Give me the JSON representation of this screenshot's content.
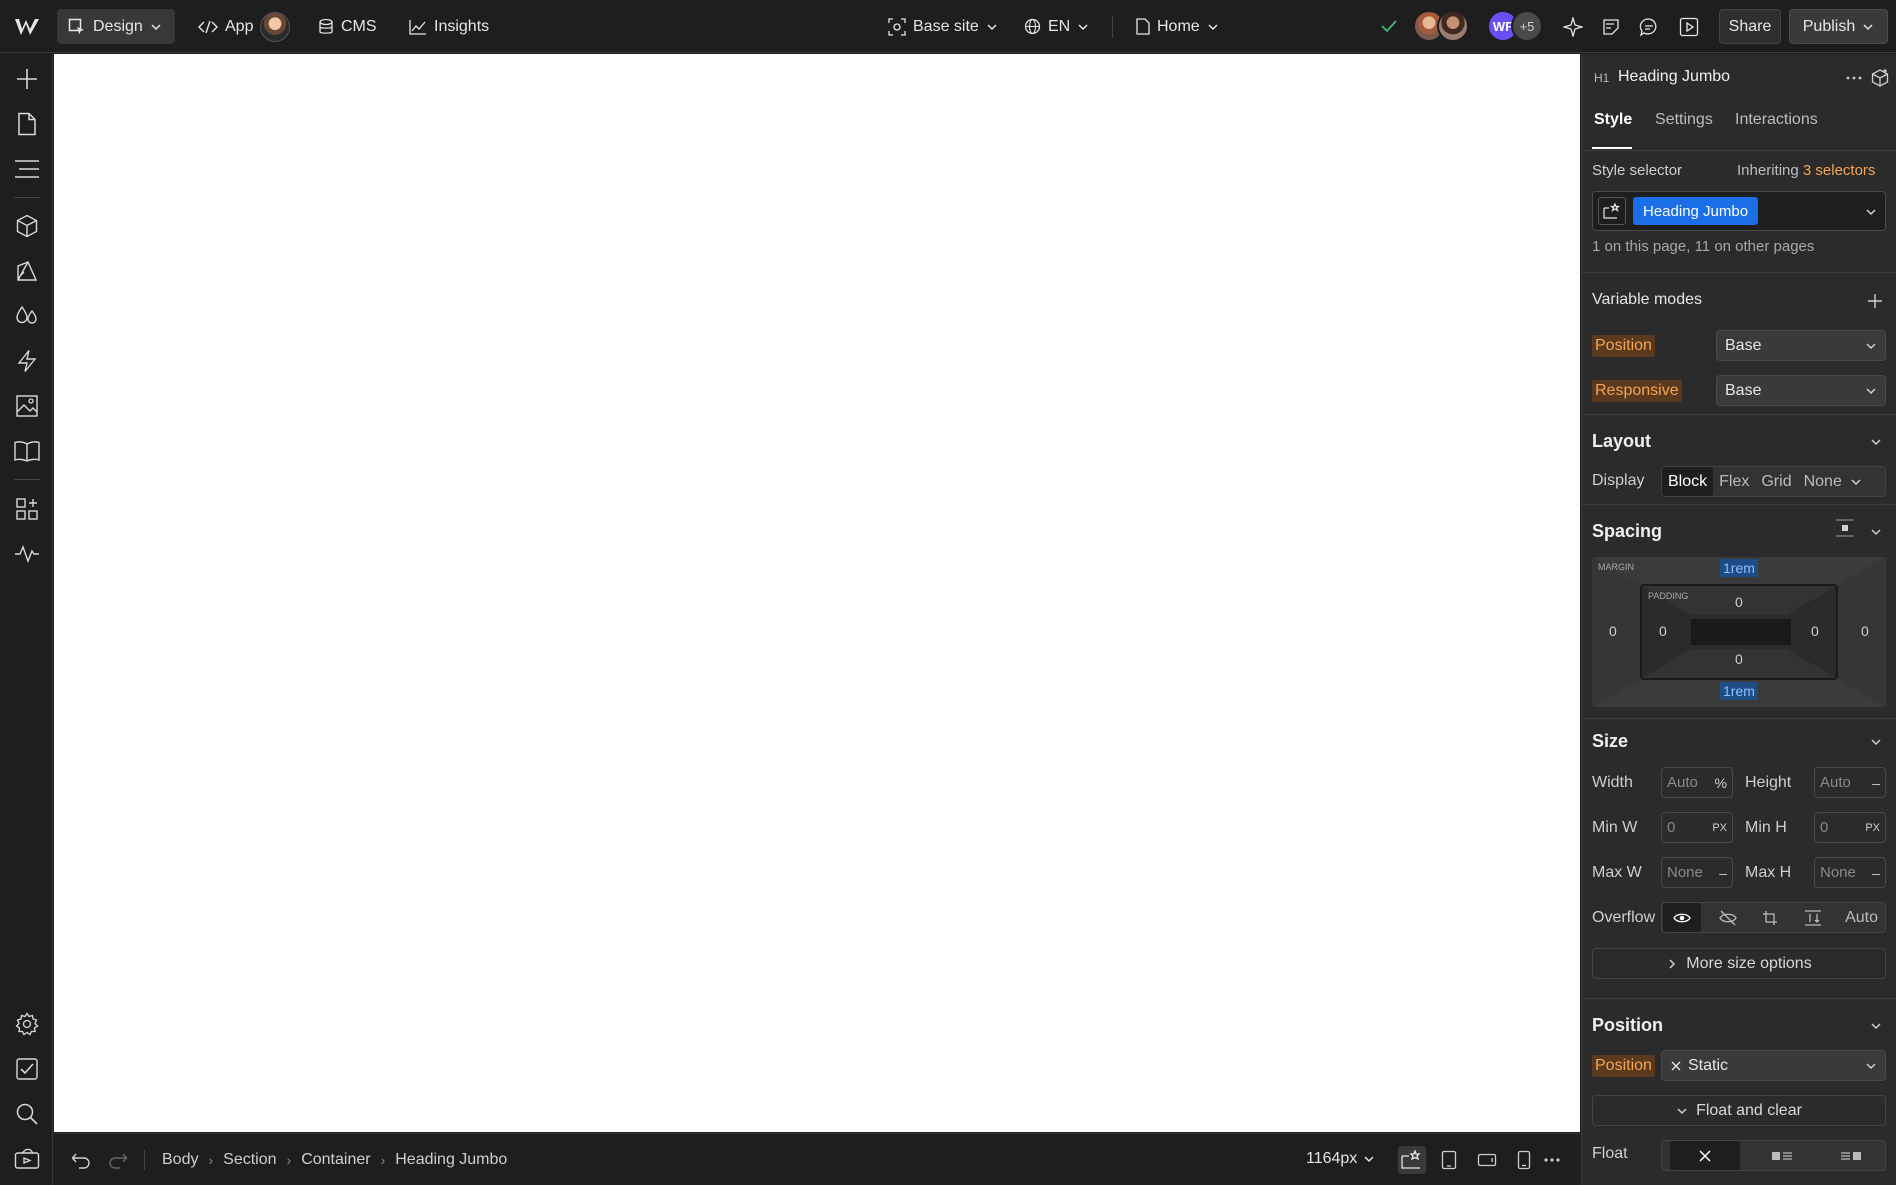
{
  "topbar": {
    "mode_label": "Design",
    "app_label": "App",
    "cms_label": "CMS",
    "insights_label": "Insights",
    "site_label": "Base site",
    "locale_label": "EN",
    "page_label": "Home",
    "collab_initials": "WF",
    "collab_more": "+5",
    "share_label": "Share",
    "publish_label": "Publish"
  },
  "breadcrumbs": [
    "Body",
    "Section",
    "Container",
    "Heading Jumbo"
  ],
  "canvas": {
    "width_readout": "1164px"
  },
  "panel": {
    "element_tag": "H1",
    "element_name": "Heading Jumbo",
    "tabs": [
      "Style",
      "Settings",
      "Interactions"
    ],
    "active_tab": "Style",
    "style_selector_label": "Style selector",
    "inheriting_prefix": "Inheriting",
    "inheriting_count": "3 selectors",
    "selector_chip": "Heading Jumbo",
    "selector_usage": "1 on this page, 11 on other pages",
    "variable_modes": {
      "title": "Variable modes",
      "rows": [
        {
          "label": "Position",
          "value": "Base"
        },
        {
          "label": "Responsive",
          "value": "Base"
        }
      ]
    },
    "layout": {
      "title": "Layout",
      "display_label": "Display",
      "options": [
        "Block",
        "Flex",
        "Grid",
        "None"
      ],
      "selected": "Block"
    },
    "spacing": {
      "title": "Spacing",
      "margin_label": "MARGIN",
      "padding_label": "PADDING",
      "margin_top": "1rem",
      "margin_bottom": "1rem",
      "margin_left": "0",
      "margin_right": "0",
      "padding_top": "0",
      "padding_bottom": "0",
      "padding_left": "0",
      "padding_right": "0"
    },
    "size": {
      "title": "Size",
      "width_label": "Width",
      "width_value": "Auto",
      "width_unit": "%",
      "height_label": "Height",
      "height_value": "Auto",
      "height_unit": "–",
      "minw_label": "Min W",
      "minw_value": "0",
      "minw_unit": "PX",
      "minh_label": "Min H",
      "minh_value": "0",
      "minh_unit": "PX",
      "maxw_label": "Max W",
      "maxw_value": "None",
      "maxw_unit": "–",
      "maxh_label": "Max H",
      "maxh_value": "None",
      "maxh_unit": "–",
      "overflow_label": "Overflow",
      "overflow_auto": "Auto",
      "more_options": "More size options"
    },
    "position": {
      "title": "Position",
      "position_label": "Position",
      "position_value": "Static",
      "float_clear_label": "Float and clear",
      "float_label": "Float"
    }
  }
}
